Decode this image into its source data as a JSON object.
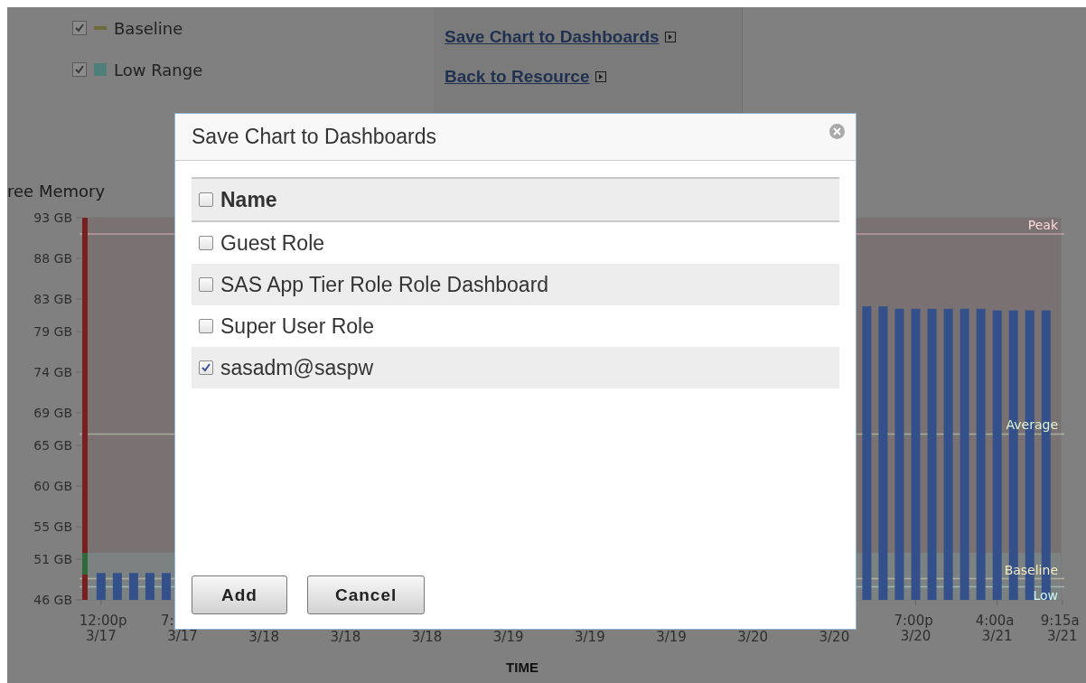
{
  "legend": [
    {
      "label": "Baseline",
      "checked": true,
      "kind": "line",
      "color": "#6f6a3c"
    },
    {
      "label": "Low Range",
      "checked": true,
      "kind": "area",
      "color": "#4f7f7a"
    }
  ],
  "links": [
    "Save Chart to Dashboards",
    "Back to Resource"
  ],
  "chart": {
    "chart_data": {
      "type": "bar",
      "title": "ree Memory",
      "xlabel": "TIME",
      "ylim": [
        46,
        93
      ],
      "yticks": [
        {
          "value": 46,
          "label": "46 GB"
        },
        {
          "value": 51,
          "label": "51 GB"
        },
        {
          "value": 55,
          "label": "55 GB"
        },
        {
          "value": 60,
          "label": "60 GB"
        },
        {
          "value": 65,
          "label": "65 GB"
        },
        {
          "value": 69,
          "label": "69 GB"
        },
        {
          "value": 74,
          "label": "74 GB"
        },
        {
          "value": 79,
          "label": "79 GB"
        },
        {
          "value": 83,
          "label": "83 GB"
        },
        {
          "value": 88,
          "label": "88 GB"
        },
        {
          "value": 93,
          "label": "93 GB"
        }
      ],
      "categories": [
        "12:00p\n3/17",
        null,
        null,
        null,
        null,
        "7:\n3/17",
        null,
        null,
        null,
        null,
        "3/18",
        null,
        null,
        null,
        null,
        "3/18",
        null,
        null,
        null,
        null,
        "3/18",
        null,
        null,
        null,
        null,
        "3/19",
        null,
        null,
        null,
        null,
        "3/19",
        null,
        null,
        null,
        null,
        "3/19",
        null,
        null,
        null,
        null,
        "3/20",
        null,
        null,
        null,
        null,
        "3/20",
        null,
        null,
        null,
        null,
        "7:00p\n3/20",
        null,
        null,
        null,
        null,
        "4:00a\n3/21",
        null,
        null,
        null,
        "9:15a\n3/21"
      ],
      "series": [
        {
          "color": "#34508a",
          "values": [
            49.3,
            49.3,
            49.3,
            49.3,
            49.3,
            null,
            null,
            null,
            null,
            null,
            null,
            null,
            null,
            null,
            null,
            null,
            null,
            null,
            null,
            null,
            null,
            null,
            null,
            null,
            null,
            null,
            null,
            null,
            null,
            null,
            null,
            null,
            null,
            null,
            null,
            null,
            null,
            null,
            null,
            null,
            null,
            null,
            null,
            null,
            null,
            null,
            null,
            82.1,
            82.1,
            81.8,
            81.8,
            81.8,
            81.8,
            81.8,
            81.8,
            81.6,
            81.6,
            81.6,
            81.6,
            null
          ]
        }
      ],
      "bands": [
        {
          "axis": "y",
          "from": 46,
          "to": 51.8,
          "color": "#7c8282"
        }
      ],
      "ref_lines": [
        {
          "axis": "y",
          "label": "Peak",
          "value": 91,
          "color": "#ffd8d8"
        },
        {
          "axis": "y",
          "label": "Average",
          "value": 66.4,
          "color": "#dff5cf"
        },
        {
          "axis": "y",
          "label": "Baseline",
          "value": 48.6,
          "color": "#f5ecc0"
        },
        {
          "axis": "y",
          "label": "Low",
          "value": 47.6,
          "color": "#cff5ef"
        }
      ]
    }
  },
  "dialog": {
    "title": "Save Chart to Dashboards",
    "header": {
      "label": "Name",
      "checked": false
    },
    "rows": [
      {
        "name": "Guest Role",
        "checked": false
      },
      {
        "name": "SAS App Tier Role Role Dashboard",
        "checked": false
      },
      {
        "name": "Super User Role",
        "checked": false
      },
      {
        "name": "sasadm@saspw",
        "checked": true
      }
    ],
    "buttons": [
      "Add",
      "Cancel"
    ]
  }
}
